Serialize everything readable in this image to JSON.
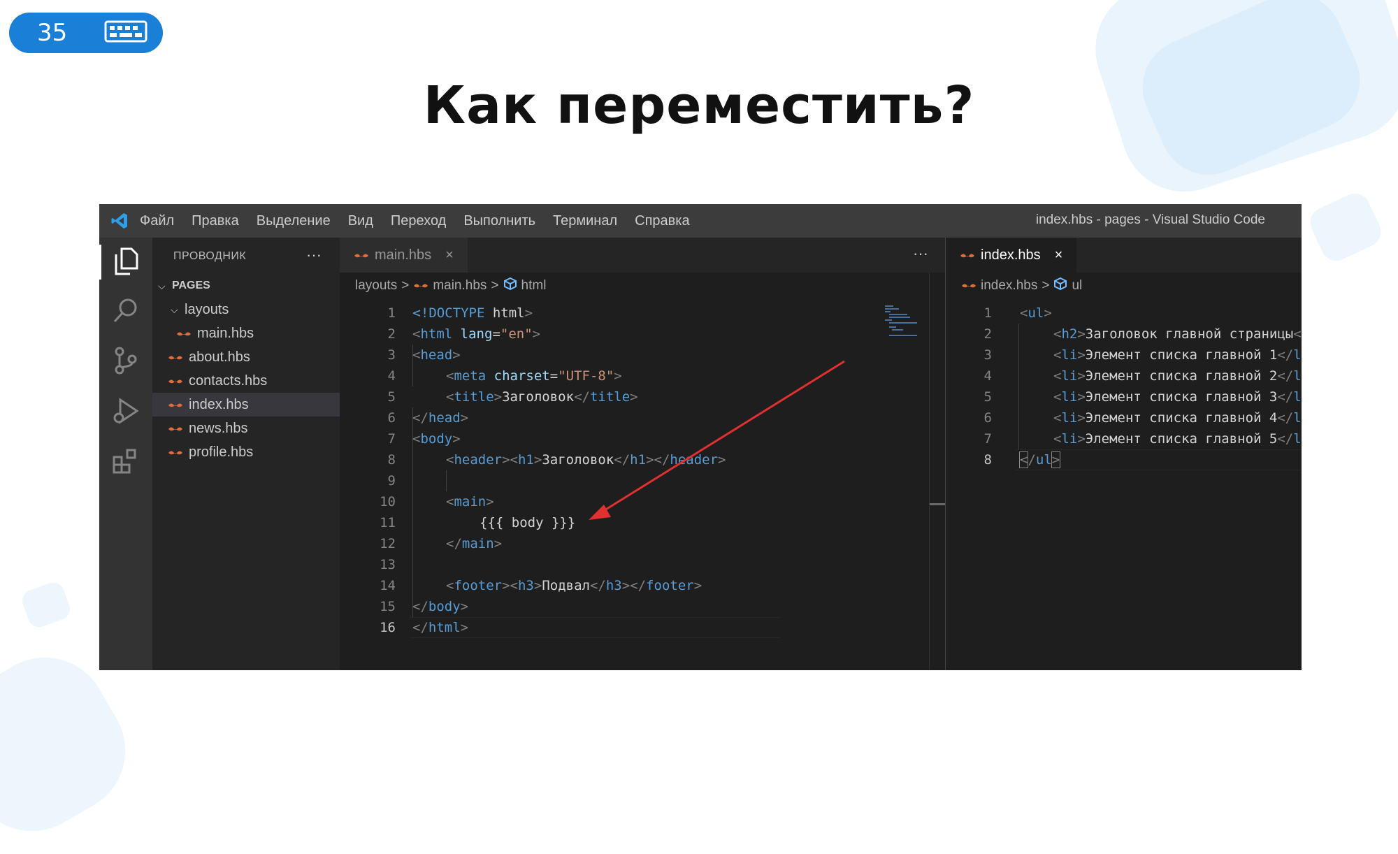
{
  "slide": {
    "number": "35",
    "title": "Как переместить?",
    "keyboard_icon": "keyboard-icon",
    "accent_color": "#1a7fd6"
  },
  "vscode": {
    "menu": [
      "Файл",
      "Правка",
      "Выделение",
      "Вид",
      "Переход",
      "Выполнить",
      "Терминал",
      "Справка"
    ],
    "window_title": "index.hbs - pages - Visual Studio Code",
    "activity_icons": [
      "files-icon",
      "search-icon",
      "source-control-icon",
      "run-debug-icon",
      "extensions-icon"
    ],
    "explorer": {
      "header": "ПРОВОДНИК",
      "more": "···",
      "root": "PAGES",
      "folder": "layouts",
      "folder_files": [
        "main.hbs"
      ],
      "files": [
        "about.hbs",
        "contacts.hbs",
        "index.hbs",
        "news.hbs",
        "profile.hbs"
      ],
      "selected": "index.hbs"
    },
    "editor_left": {
      "tab": "main.hbs",
      "tab_close": "×",
      "more": "···",
      "breadcrumb": [
        "layouts",
        ">",
        "main.hbs",
        ">",
        "html"
      ],
      "lines": [
        {
          "n": "1"
        },
        {
          "n": "2"
        },
        {
          "n": "3"
        },
        {
          "n": "4"
        },
        {
          "n": "5"
        },
        {
          "n": "6"
        },
        {
          "n": "7"
        },
        {
          "n": "8"
        },
        {
          "n": "9"
        },
        {
          "n": "10"
        },
        {
          "n": "11"
        },
        {
          "n": "12"
        },
        {
          "n": "13"
        },
        {
          "n": "14"
        },
        {
          "n": "15"
        },
        {
          "n": "16"
        }
      ],
      "code": {
        "doctype": "<!DOCTYPE",
        "doctype_html": " html",
        "doctype_end": ">",
        "html_open": "html",
        "lang_attr": "lang",
        "lang_val": "\"en\"",
        "head": "head",
        "meta": "meta",
        "charset": "charset",
        "charset_val": "\"UTF-8\"",
        "title_tag": "title",
        "title_text": "Заголовок",
        "body": "body",
        "header": "header",
        "h1": "h1",
        "h1_text": "Заголовок",
        "main": "main",
        "body_expr": "{{{ body }}}",
        "footer": "footer",
        "h3": "h3",
        "h3_text": "Подвал"
      }
    },
    "editor_right": {
      "tab": "index.hbs",
      "tab_close": "×",
      "breadcrumb": [
        "index.hbs",
        ">",
        "ul"
      ],
      "lines": [
        {
          "n": "1"
        },
        {
          "n": "2"
        },
        {
          "n": "3"
        },
        {
          "n": "4"
        },
        {
          "n": "5"
        },
        {
          "n": "6"
        },
        {
          "n": "7"
        },
        {
          "n": "8"
        }
      ],
      "code": {
        "ul": "ul",
        "h2": "h2",
        "h2_text": "Заголовок главной страницы",
        "li": "li",
        "items": [
          "Элемент списка главной 1",
          "Элемент списка главной 2",
          "Элемент списка главной 3",
          "Элемент списка главной 4",
          "Элемент списка главной 5"
        ]
      }
    },
    "arrow_color": "#e03030"
  }
}
